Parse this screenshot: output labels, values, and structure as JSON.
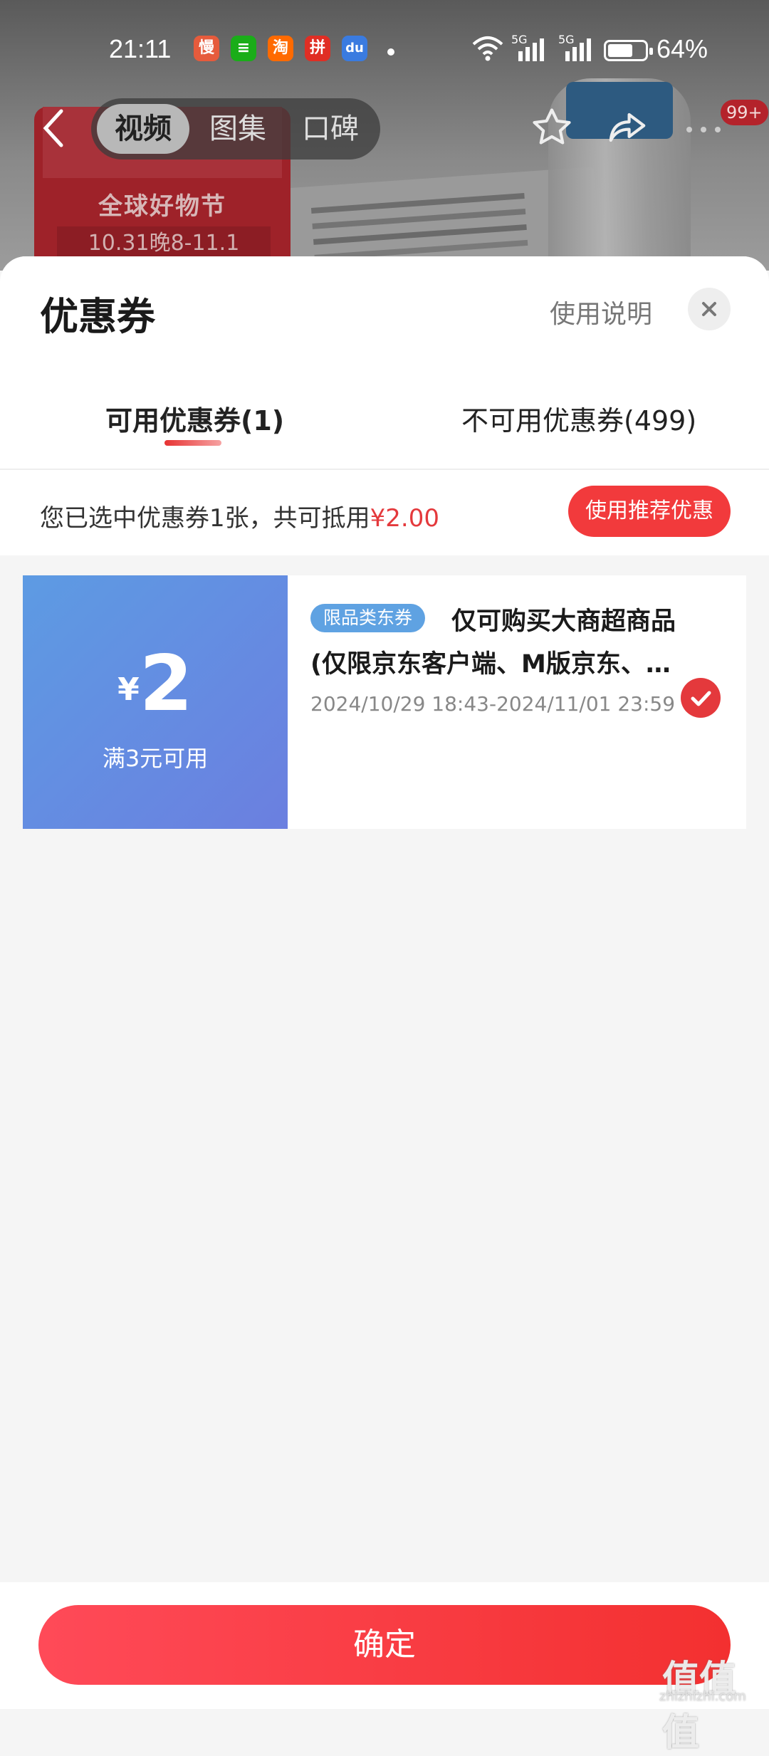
{
  "status_bar": {
    "time": "21:11",
    "battery": "64%",
    "signal1": "5G",
    "signal2": "5G",
    "app_icons": [
      {
        "name": "慢",
        "color": "#e65b3c"
      },
      {
        "name": "≡",
        "color": "#1aad19"
      },
      {
        "name": "淘",
        "color": "#ff6a00"
      },
      {
        "name": "拼",
        "color": "#e02e24"
      },
      {
        "name": "du",
        "color": "#3a7be0"
      }
    ]
  },
  "nav": {
    "tabs": [
      "视频",
      "图集",
      "口碑"
    ],
    "active_tab": 0,
    "badge": "99+"
  },
  "background_promo": {
    "title": "全球好物节",
    "date": "10.31晚8-11.1"
  },
  "sheet": {
    "title": "优惠券",
    "help": "使用说明",
    "tabs": [
      {
        "label": "可用优惠券(1)",
        "active": true
      },
      {
        "label": "不可用优惠券(499)",
        "active": false
      }
    ],
    "summary_prefix": "您已选中优惠券1张，共可抵用",
    "summary_amount": "¥2.00",
    "recommend_button": "使用推荐优惠"
  },
  "coupon": {
    "currency": "¥",
    "amount": "2",
    "condition": "满3元可用",
    "tag": "限品类东券",
    "desc_line1": "仅可购买大商超商品",
    "desc_line2": "(仅限京东客户端、M版京东、京东小程序使用)",
    "validity": "2024/10/29 18:43-2024/11/01 23:59",
    "selected": true
  },
  "footer": {
    "confirm": "确定"
  },
  "watermark": {
    "main": "值值值",
    "sub": "zhizhizhi.com"
  },
  "colors": {
    "accent": "#e4393c",
    "coupon_gradient_start": "#5d9be3",
    "coupon_gradient_end": "#6b7fe0"
  }
}
